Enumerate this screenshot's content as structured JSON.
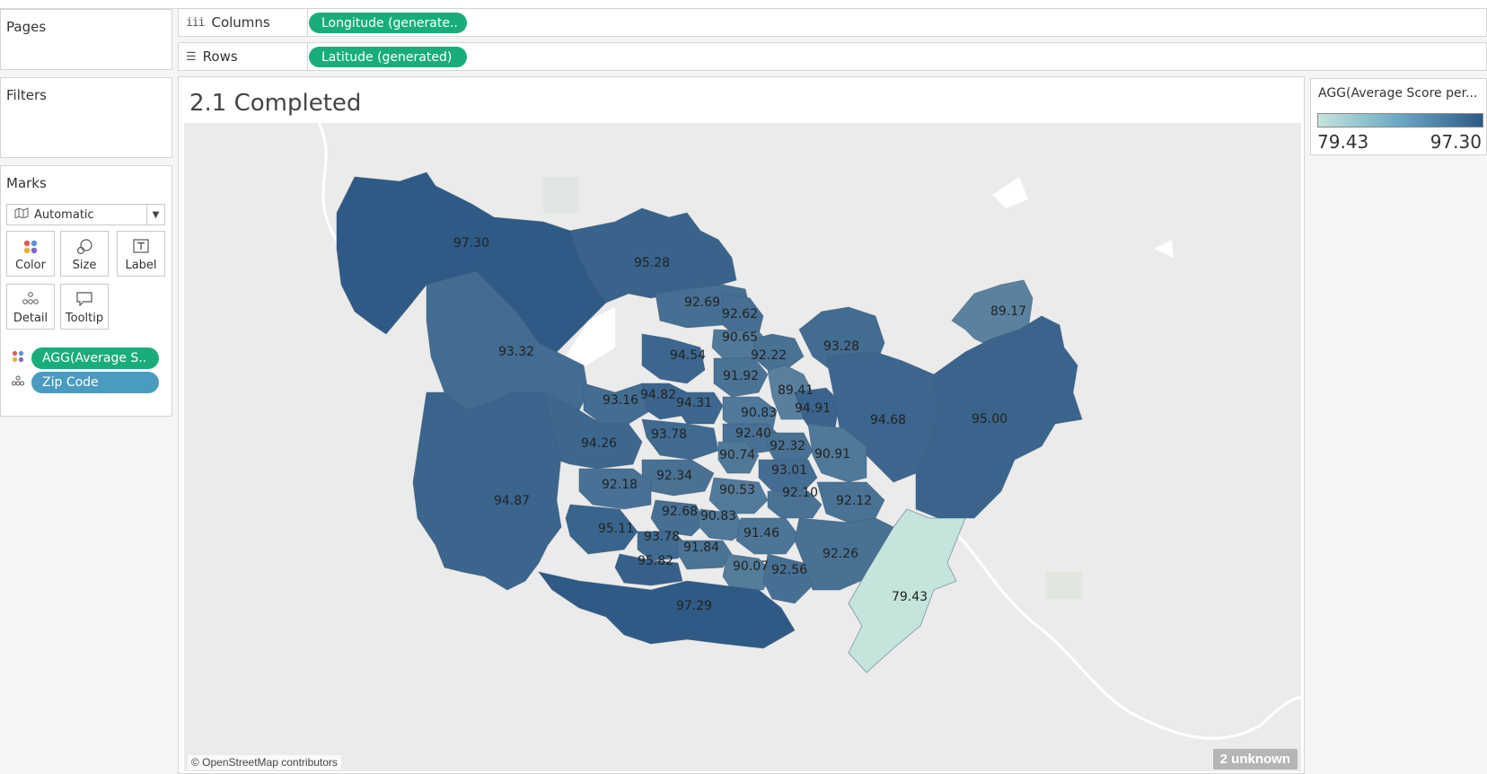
{
  "cards": {
    "pages_title": "Pages",
    "filters_title": "Filters",
    "marks_title": "Marks"
  },
  "shelves": {
    "columns": {
      "label": "Columns",
      "icon": "columns-icon",
      "pill": "Longitude (generate.."
    },
    "rows": {
      "label": "Rows",
      "icon": "rows-icon",
      "pill": "Latitude (generated)"
    }
  },
  "marks": {
    "mark_type": "Automatic",
    "buttons": {
      "color": "Color",
      "size": "Size",
      "label": "Label",
      "detail": "Detail",
      "tooltip": "Tooltip"
    },
    "fields": {
      "color_field": "AGG(Average S..",
      "detail_field": "Zip Code"
    }
  },
  "viz": {
    "title": "2.1 Completed",
    "attribution": "© OpenStreetMap contributors",
    "unknown_badge": "2 unknown"
  },
  "legend": {
    "title": "AGG(Average Score per...",
    "min": "79.43",
    "max": "97.30"
  },
  "colors": {
    "accent_green": "#19ad7c",
    "accent_blue": "#4a9bc0",
    "ramp_low": "#c5e4dc",
    "ramp_high": "#2f5a86"
  },
  "map_regions": [
    {
      "label": "97.30"
    },
    {
      "label": "95.28"
    },
    {
      "label": "92.69"
    },
    {
      "label": "92.62"
    },
    {
      "label": "89.17"
    },
    {
      "label": "90.65"
    },
    {
      "label": "93.32"
    },
    {
      "label": "93.28"
    },
    {
      "label": "94.54"
    },
    {
      "label": "92.22"
    },
    {
      "label": "91.92"
    },
    {
      "label": "89.41"
    },
    {
      "label": "93.16"
    },
    {
      "label": "94.82"
    },
    {
      "label": "94.31"
    },
    {
      "label": "94.91"
    },
    {
      "label": "90.83"
    },
    {
      "label": "94.68"
    },
    {
      "label": "95.00"
    },
    {
      "label": "92.40"
    },
    {
      "label": "93.78"
    },
    {
      "label": "94.26"
    },
    {
      "label": "92.32"
    },
    {
      "label": "90.74"
    },
    {
      "label": "90.91"
    },
    {
      "label": "93.01"
    },
    {
      "label": "92.34"
    },
    {
      "label": "92.18"
    },
    {
      "label": "90.53"
    },
    {
      "label": "92.10"
    },
    {
      "label": "92.12"
    },
    {
      "label": "94.87"
    },
    {
      "label": "92.68"
    },
    {
      "label": "90.83"
    },
    {
      "label": "95.11"
    },
    {
      "label": "91.46"
    },
    {
      "label": "93.78"
    },
    {
      "label": "91.84"
    },
    {
      "label": "92.26"
    },
    {
      "label": "95.82"
    },
    {
      "label": "90.07"
    },
    {
      "label": "92.56"
    },
    {
      "label": "79.43"
    },
    {
      "label": "97.29"
    }
  ]
}
